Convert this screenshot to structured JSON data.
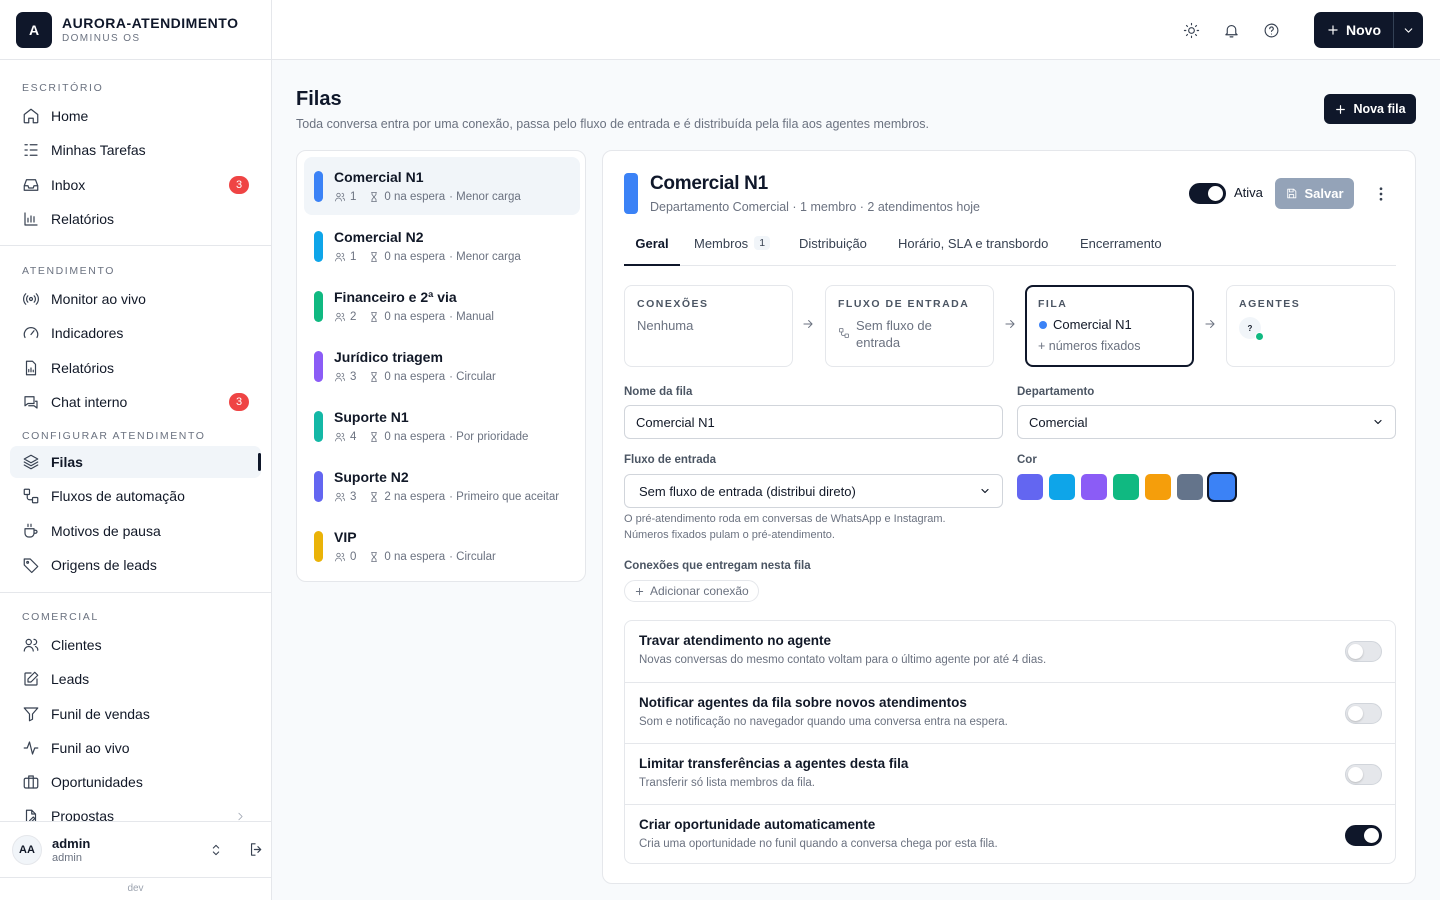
{
  "brand": {
    "logo_letter": "A",
    "name": "AURORA-ATENDIMENTO",
    "subtitle": "DOMINUS OS"
  },
  "sidebar": {
    "sections": [
      {
        "label": "ESCRITÓRIO",
        "items": [
          {
            "label": "Home",
            "icon": "home-icon"
          },
          {
            "label": "Minhas Tarefas",
            "icon": "tasks-icon"
          },
          {
            "label": "Inbox",
            "icon": "inbox-icon",
            "badge": "3"
          },
          {
            "label": "Relatórios",
            "icon": "bar-chart-icon"
          }
        ]
      },
      {
        "label": "ATENDIMENTO",
        "items": [
          {
            "label": "Monitor ao vivo",
            "icon": "radio-icon"
          },
          {
            "label": "Indicadores",
            "icon": "gauge-icon"
          },
          {
            "label": "Relatórios",
            "icon": "file-chart-icon"
          },
          {
            "label": "Chat interno",
            "icon": "chat-icon",
            "badge": "3"
          }
        ]
      },
      {
        "label": "CONFIGURAR ATENDIMENTO",
        "items": [
          {
            "label": "Filas",
            "icon": "layers-icon",
            "active": true
          },
          {
            "label": "Fluxos de automação",
            "icon": "workflow-icon"
          },
          {
            "label": "Motivos de pausa",
            "icon": "coffee-icon"
          },
          {
            "label": "Origens de leads",
            "icon": "tag-icon"
          }
        ]
      },
      {
        "label": "COMERCIAL",
        "items": [
          {
            "label": "Clientes",
            "icon": "users-icon"
          },
          {
            "label": "Leads",
            "icon": "edit-icon"
          },
          {
            "label": "Funil de vendas",
            "icon": "filter-icon"
          },
          {
            "label": "Funil ao vivo",
            "icon": "activity-icon"
          },
          {
            "label": "Oportunidades",
            "icon": "briefcase-icon"
          },
          {
            "label": "Propostas",
            "icon": "file-pen-icon"
          }
        ]
      }
    ],
    "user": {
      "initials": "AA",
      "name": "admin",
      "role": "admin"
    },
    "env": "dev"
  },
  "topbar": {
    "new_label": "Novo"
  },
  "page": {
    "title": "Filas",
    "subtitle": "Toda conversa entra por uma conexão, passa pelo fluxo de entrada e é distribuída pela fila aos agentes membros.",
    "new_queue_label": "Nova fila"
  },
  "queues": [
    {
      "name": "Comercial N1",
      "members": "1",
      "waiting": "0 na espera",
      "mode": "· Menor carga",
      "color": "#3b82f6",
      "selected": true
    },
    {
      "name": "Comercial N2",
      "members": "1",
      "waiting": "0 na espera",
      "mode": "· Menor carga",
      "color": "#0ea5e9"
    },
    {
      "name": "Financeiro e 2ª via",
      "members": "2",
      "waiting": "0 na espera",
      "mode": "· Manual",
      "color": "#10b981"
    },
    {
      "name": "Jurídico triagem",
      "members": "3",
      "waiting": "0 na espera",
      "mode": "· Circular",
      "color": "#8b5cf6"
    },
    {
      "name": "Suporte N1",
      "members": "4",
      "waiting": "0 na espera",
      "mode": "· Por prioridade",
      "color": "#14b8a6"
    },
    {
      "name": "Suporte N2",
      "members": "3",
      "waiting": "2 na espera",
      "mode": "· Primeiro que aceitar",
      "color": "#6366f1"
    },
    {
      "name": "VIP",
      "members": "0",
      "waiting": "0 na espera",
      "mode": "· Circular",
      "color": "#eab308"
    }
  ],
  "detail": {
    "title": "Comercial N1",
    "subtitle": "Departamento Comercial · 1 membro · 2 atendimentos hoje",
    "active_label": "Ativa",
    "save_label": "Salvar",
    "tabs": [
      {
        "label": "Geral",
        "active": true
      },
      {
        "label": "Membros",
        "count": "1"
      },
      {
        "label": "Distribuição"
      },
      {
        "label": "Horário, SLA e transbordo"
      },
      {
        "label": "Encerramento"
      }
    ],
    "flow": {
      "connections": {
        "label": "CONEXÕES",
        "value": "Nenhuma"
      },
      "entry_flow": {
        "label": "FLUXO DE ENTRADA",
        "value": "Sem fluxo de entrada"
      },
      "queue": {
        "label": "FILA",
        "value": "Comercial N1",
        "extra": "+ números fixados"
      },
      "agents": {
        "label": "AGENTES",
        "agent_initial": "?"
      }
    },
    "form": {
      "name_label": "Nome da fila",
      "name_value": "Comercial N1",
      "department_label": "Departamento",
      "department_value": "Comercial",
      "entry_flow_label": "Fluxo de entrada",
      "entry_flow_value": "Sem fluxo de entrada (distribui direto)",
      "hint_line1": "O pré-atendimento roda em conversas de WhatsApp e Instagram.",
      "hint_line2": "Números fixados pulam o pré-atendimento.",
      "color_label": "Cor",
      "colors": [
        "#6366f1",
        "#0ea5e9",
        "#8b5cf6",
        "#10b981",
        "#f59e0b",
        "#64748b",
        "#3b82f6"
      ],
      "selected_color": "#3b82f6",
      "connections_label": "Conexões que entregam nesta fila",
      "add_connection_label": "Adicionar conexão"
    },
    "settings": [
      {
        "title": "Travar atendimento no agente",
        "description": "Novas conversas do mesmo contato voltam para o último agente por até 4 dias.",
        "enabled": false
      },
      {
        "title": "Notificar agentes da fila sobre novos atendimentos",
        "description": "Som e notificação no navegador quando uma conversa entra na espera.",
        "enabled": false
      },
      {
        "title": "Limitar transferências a agentes desta fila",
        "description": "Transferir só lista membros da fila.",
        "enabled": false
      },
      {
        "title": "Criar oportunidade automaticamente",
        "description": "Cria uma oportunidade no funil quando a conversa chega por esta fila.",
        "enabled": true
      }
    ]
  }
}
